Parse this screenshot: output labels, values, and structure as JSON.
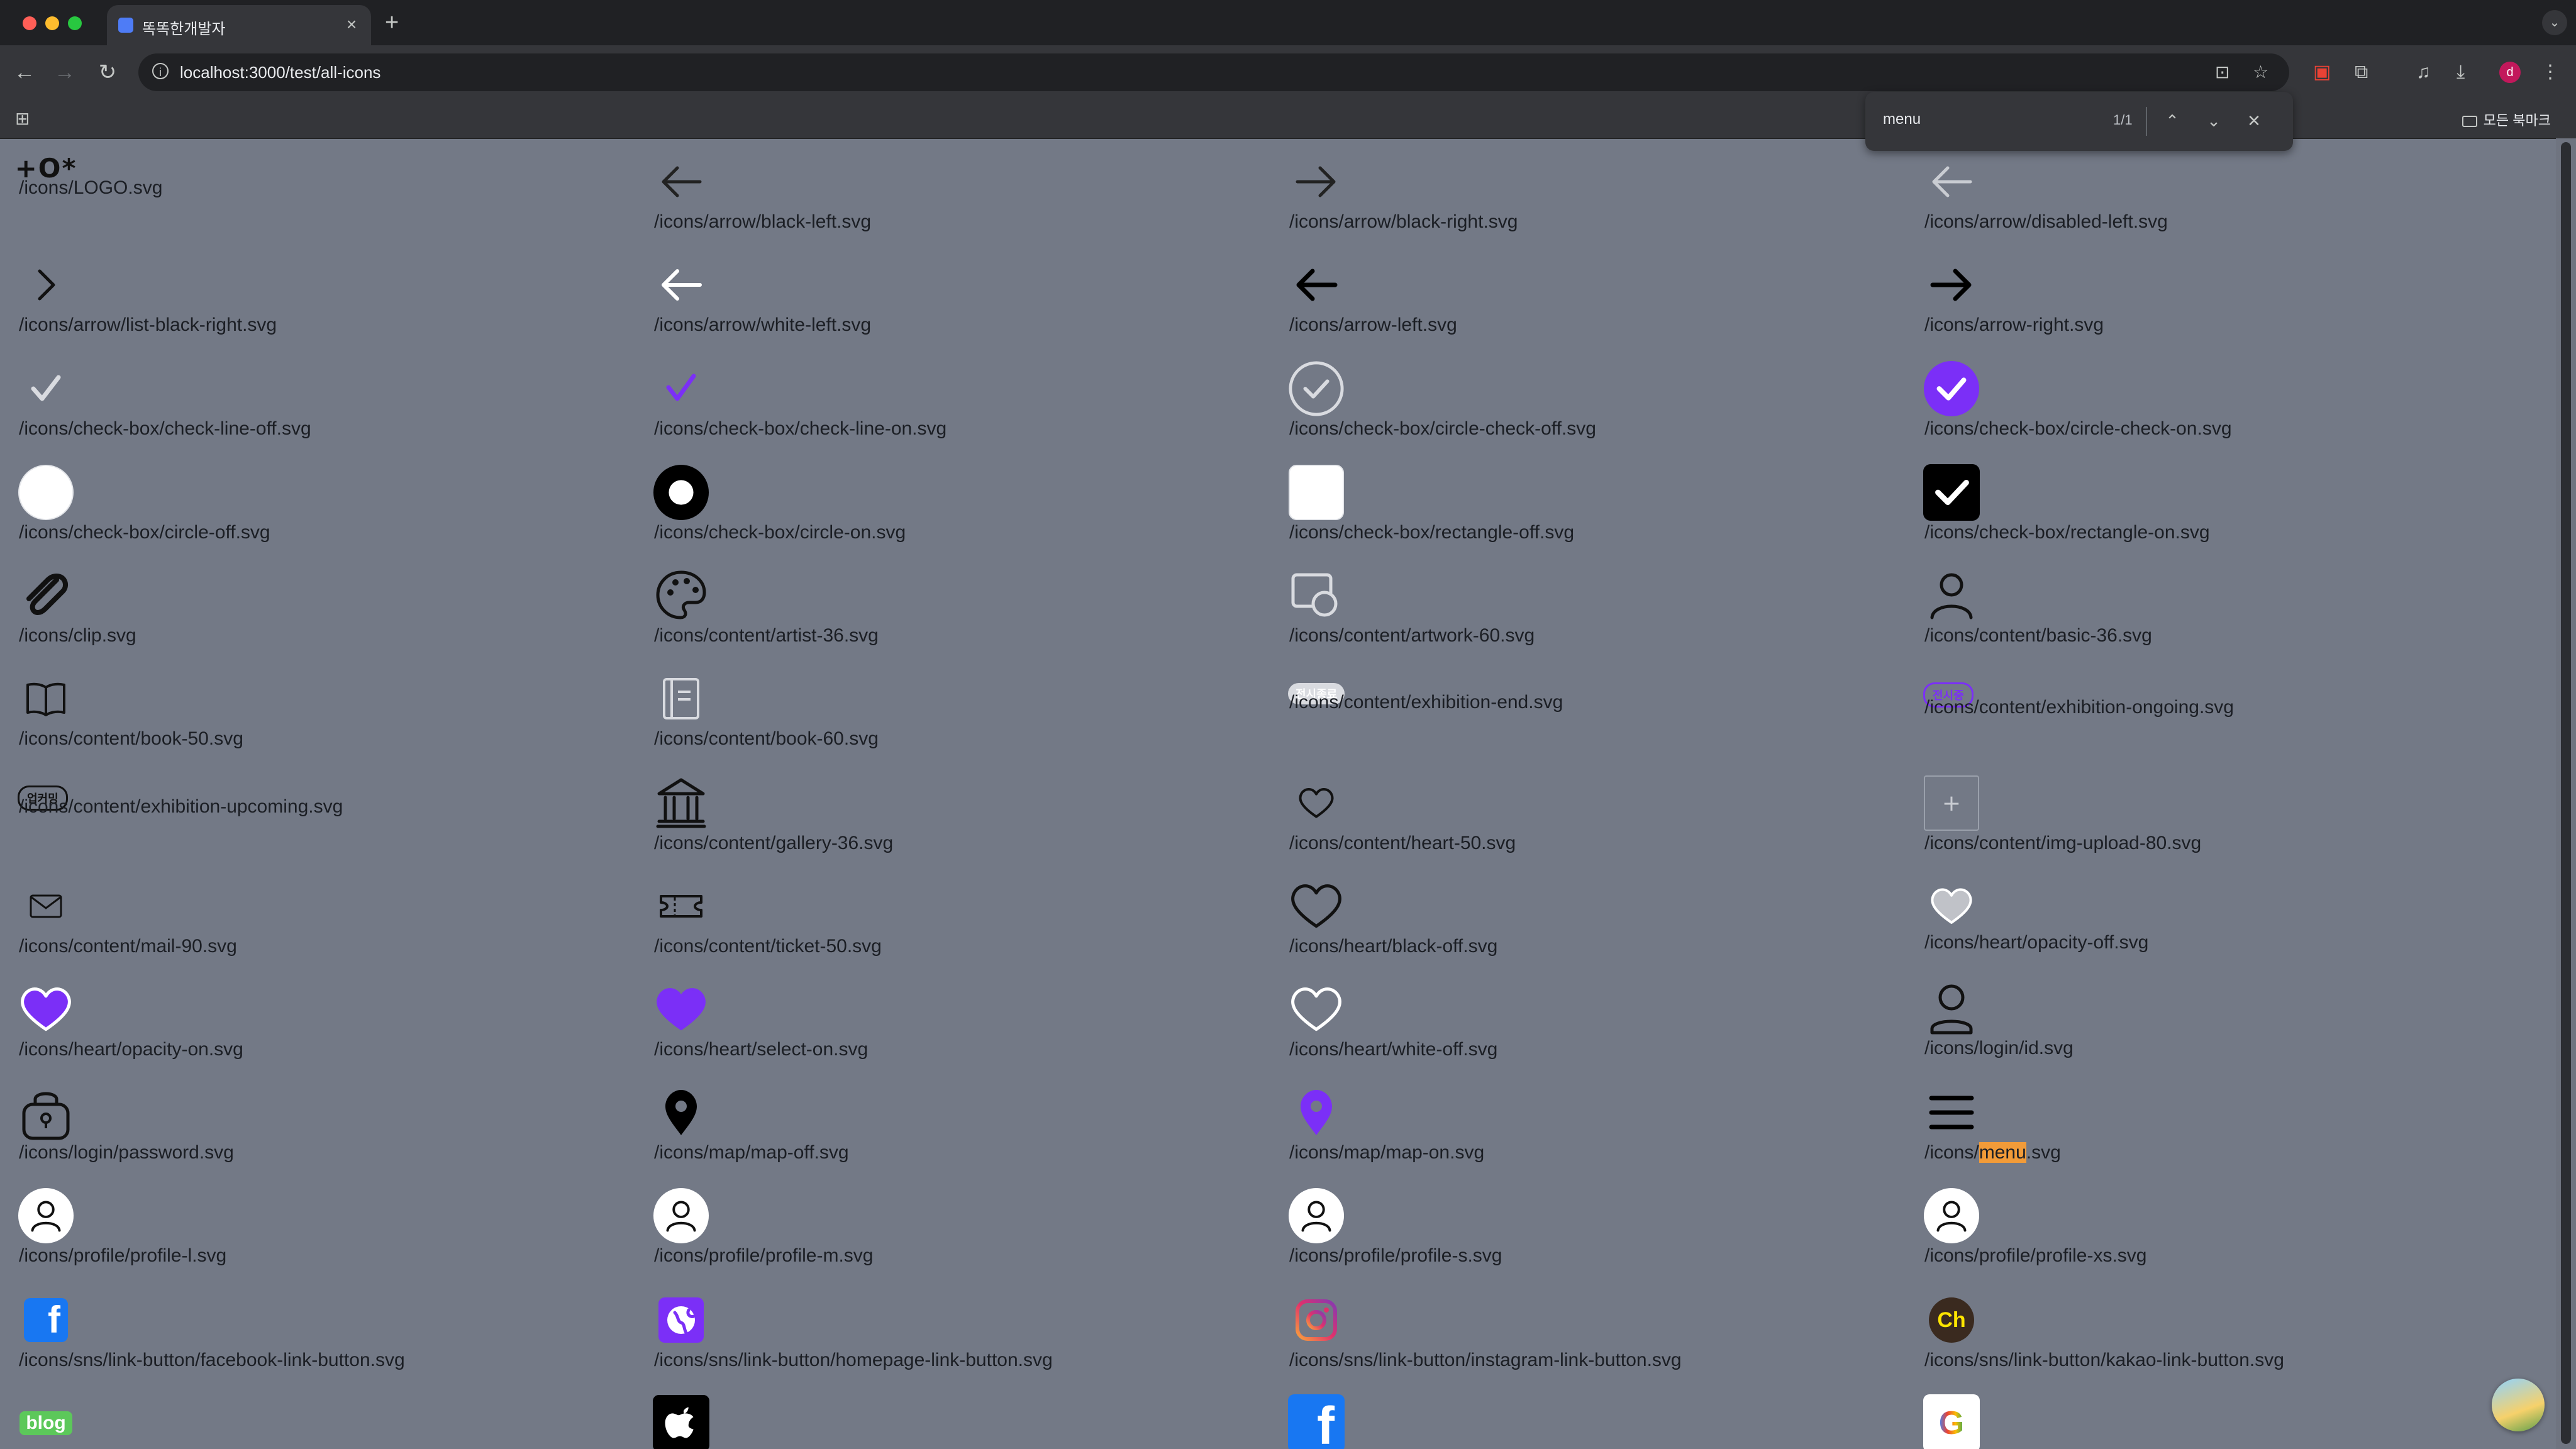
{
  "tab": {
    "title": "똑똑한개발자"
  },
  "address": {
    "url": "localhost:3000/test/all-icons"
  },
  "bookmarks": {
    "all_label": "모든 북마크"
  },
  "find": {
    "query": "menu",
    "count": "1/1"
  },
  "icons": [
    {
      "path": "/icons/LOGO.svg",
      "icon": "logo"
    },
    {
      "path": "/icons/arrow/black-left.svg",
      "icon": "arrow-left"
    },
    {
      "path": "/icons/arrow/black-right.svg",
      "icon": "arrow-right"
    },
    {
      "path": "/icons/arrow/disabled-left.svg",
      "icon": "arrow-left-disabled"
    },
    {
      "path": "/icons/arrow/list-black-right.svg",
      "icon": "chevron-right"
    },
    {
      "path": "/icons/arrow/white-left.svg",
      "icon": "arrow-left-white"
    },
    {
      "path": "/icons/arrow-left.svg",
      "icon": "arrow-left-bold"
    },
    {
      "path": "/icons/arrow-right.svg",
      "icon": "arrow-right-bold"
    },
    {
      "path": "/icons/check-box/check-line-off.svg",
      "icon": "check-off"
    },
    {
      "path": "/icons/check-box/check-line-on.svg",
      "icon": "check-on"
    },
    {
      "path": "/icons/check-box/circle-check-off.svg",
      "icon": "circle-check-off"
    },
    {
      "path": "/icons/check-box/circle-check-on.svg",
      "icon": "circle-check-on"
    },
    {
      "path": "/icons/check-box/circle-off.svg",
      "icon": "circle-off"
    },
    {
      "path": "/icons/check-box/circle-on.svg",
      "icon": "circle-on"
    },
    {
      "path": "/icons/check-box/rectangle-off.svg",
      "icon": "rectangle-off"
    },
    {
      "path": "/icons/check-box/rectangle-on.svg",
      "icon": "rectangle-on"
    },
    {
      "path": "/icons/clip.svg",
      "icon": "clip"
    },
    {
      "path": "/icons/content/artist-36.svg",
      "icon": "palette"
    },
    {
      "path": "/icons/content/artwork-60.svg",
      "icon": "artwork"
    },
    {
      "path": "/icons/content/basic-36.svg",
      "icon": "person"
    },
    {
      "path": "/icons/content/book-50.svg",
      "icon": "book-open"
    },
    {
      "path": "/icons/content/book-60.svg",
      "icon": "book"
    },
    {
      "path": "/icons/content/exhibition-end.svg",
      "icon": "badge-end",
      "badge": "전시종료"
    },
    {
      "path": "/icons/content/exhibition-ongoing.svg",
      "icon": "badge-ongoing",
      "badge": "전시중"
    },
    {
      "path": "/icons/content/exhibition-upcoming.svg",
      "icon": "badge-upcoming",
      "badge": "업커밍"
    },
    {
      "path": "/icons/content/gallery-36.svg",
      "icon": "gallery"
    },
    {
      "path": "/icons/content/heart-50.svg",
      "icon": "heart-small"
    },
    {
      "path": "/icons/content/img-upload-80.svg",
      "icon": "img-upload"
    },
    {
      "path": "/icons/content/mail-90.svg",
      "icon": "mail"
    },
    {
      "path": "/icons/content/ticket-50.svg",
      "icon": "ticket"
    },
    {
      "path": "/icons/heart/black-off.svg",
      "icon": "heart-black-off"
    },
    {
      "path": "/icons/heart/opacity-off.svg",
      "icon": "heart-opacity-off"
    },
    {
      "path": "/icons/heart/opacity-on.svg",
      "icon": "heart-opacity-on"
    },
    {
      "path": "/icons/heart/select-on.svg",
      "icon": "heart-select-on"
    },
    {
      "path": "/icons/heart/white-off.svg",
      "icon": "heart-white-off"
    },
    {
      "path": "/icons/login/id.svg",
      "icon": "person-outline"
    },
    {
      "path": "/icons/login/password.svg",
      "icon": "lock"
    },
    {
      "path": "/icons/map/map-off.svg",
      "icon": "pin-black"
    },
    {
      "path": "/icons/map/map-on.svg",
      "icon": "pin-purple"
    },
    {
      "path": "/icons/menu.svg",
      "icon": "menu",
      "highlight": {
        "pre": "/icons/",
        "match": "menu",
        "post": ".svg"
      }
    },
    {
      "path": "/icons/profile/profile-l.svg",
      "icon": "profile"
    },
    {
      "path": "/icons/profile/profile-m.svg",
      "icon": "profile"
    },
    {
      "path": "/icons/profile/profile-s.svg",
      "icon": "profile"
    },
    {
      "path": "/icons/profile/profile-xs.svg",
      "icon": "profile"
    },
    {
      "path": "/icons/sns/link-button/facebook-link-button.svg",
      "icon": "facebook"
    },
    {
      "path": "/icons/sns/link-button/homepage-link-button.svg",
      "icon": "homepage"
    },
    {
      "path": "/icons/sns/link-button/instagram-link-button.svg",
      "icon": "instagram"
    },
    {
      "path": "/icons/sns/link-button/kakao-link-button.svg",
      "icon": "kakao"
    },
    {
      "path": "",
      "icon": "blog",
      "badge": "blog"
    },
    {
      "path": "",
      "icon": "apple"
    },
    {
      "path": "",
      "icon": "facebook-square"
    },
    {
      "path": "",
      "icon": "google"
    }
  ],
  "logo_text": "+O*",
  "kakao_text": "Ch",
  "google_text": "G",
  "colors": {
    "page_bg": "#737986",
    "purple": "#7b2ff7",
    "text": "#1b1e24",
    "highlight": "#f29b38"
  }
}
